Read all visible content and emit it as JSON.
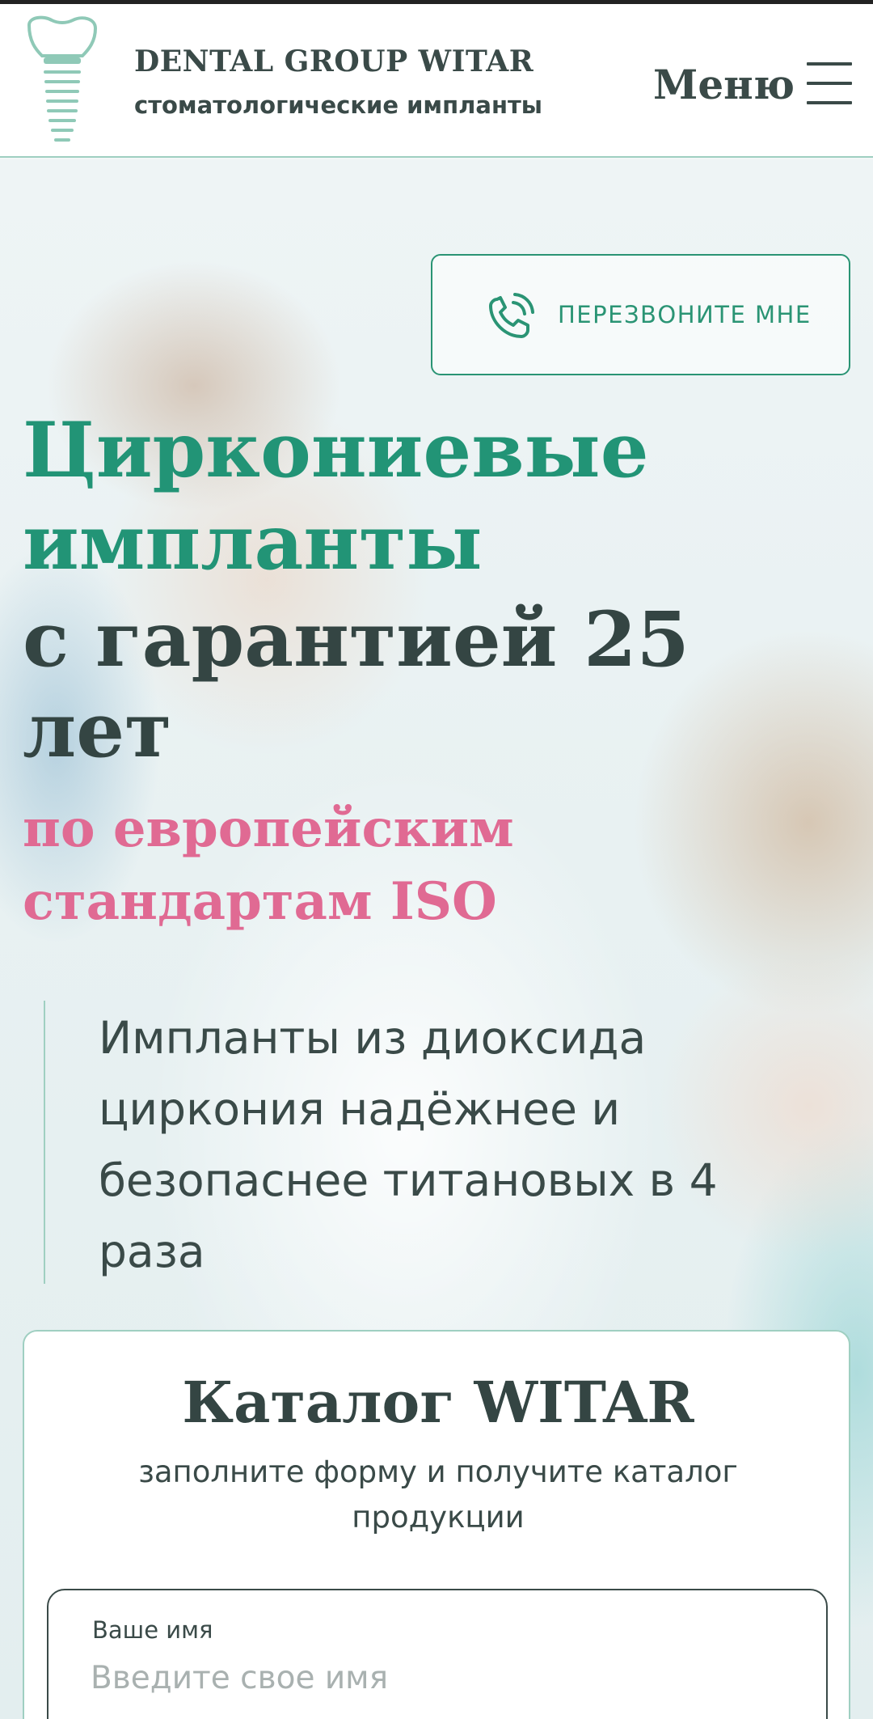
{
  "header": {
    "brand_title": "DENTAL GROUP WITAR",
    "brand_subtitle": "стоматологические импланты",
    "menu_label": "Меню",
    "logo_icon": "tooth-implant-icon",
    "menu_icon": "hamburger-icon"
  },
  "hero": {
    "callback_button": "ПЕРЕЗВОНИТЕ МНЕ",
    "callback_icon": "phone-icon",
    "headline_green_line1": "Циркониевые",
    "headline_green_line2": "импланты",
    "headline_dark_line1": "с гарантией 25",
    "headline_dark_line2": "лет",
    "headline_pink_line1": "по европейским",
    "headline_pink_line2": "стандартам ISO",
    "quote_lines": [
      "Импланты из диоксида",
      "циркония надёжнее и",
      "безопаснее титановых в 4",
      "раза"
    ]
  },
  "catalog_form": {
    "title": "Каталог WITAR",
    "subtitle_line1": "заполните форму и получите каталог",
    "subtitle_line2": "продукции",
    "name_label": "Ваше имя",
    "name_placeholder": "Введите свое имя",
    "name_value": ""
  },
  "colors": {
    "accent_green": "#229476",
    "dark_text": "#344543",
    "pink": "#e06a93",
    "border_mint": "#9fcfc1"
  }
}
